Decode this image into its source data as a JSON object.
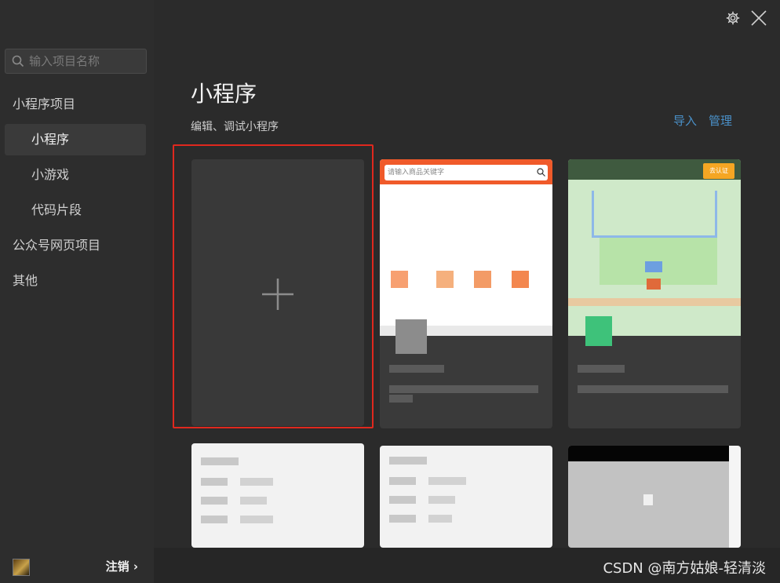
{
  "sidebar": {
    "search_placeholder": "输入项目名称",
    "categories": [
      {
        "label": "小程序项目"
      },
      {
        "label": "小程序"
      },
      {
        "label": "小游戏"
      },
      {
        "label": "代码片段"
      },
      {
        "label": "公众号网页项目"
      },
      {
        "label": "其他"
      }
    ],
    "active": "小程序",
    "logout_label": "注销",
    "logout_chevron": "›"
  },
  "main": {
    "title": "小程序",
    "subtitle": "编辑、调试小程序",
    "import_label": "导入",
    "manage_label": "管理"
  },
  "projects": [
    {
      "search_hint": "请输入商品关键字",
      "accent": "#f05a2a"
    },
    {
      "badge": "去认证",
      "accent": "#f5a623"
    }
  ],
  "watermark": "CSDN @南方姑娘-轻清淡",
  "colors": {
    "link": "#4a90c8",
    "highlight": "#e0281e",
    "background": "#2b2b2b"
  }
}
